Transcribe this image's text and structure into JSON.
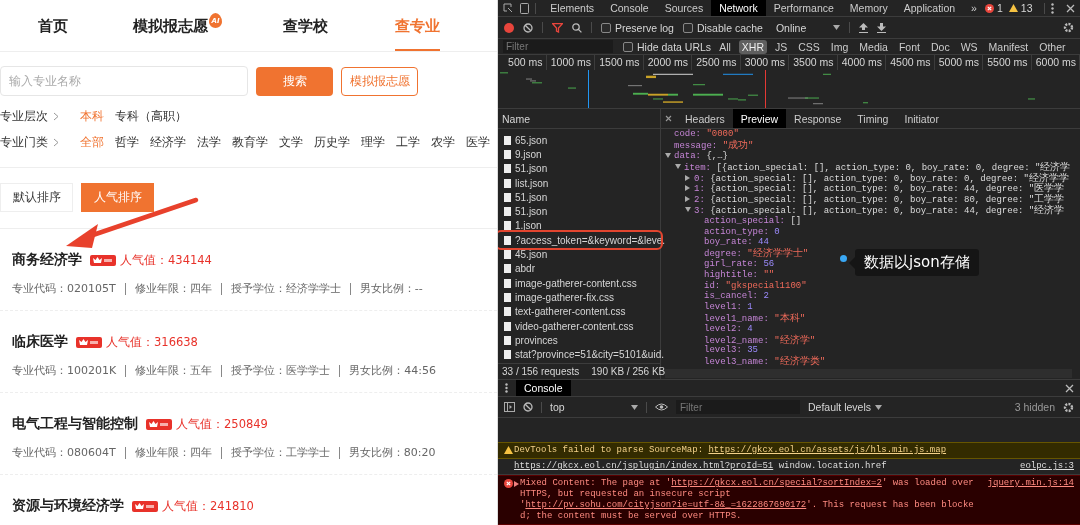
{
  "site": {
    "nav": [
      {
        "label": "首页",
        "selected": false
      },
      {
        "label": "模拟报志愿",
        "selected": false,
        "badge": "AI"
      },
      {
        "label": "查学校",
        "selected": false
      },
      {
        "label": "查专业",
        "selected": true
      }
    ],
    "search": {
      "placeholder": "输入专业名称",
      "button": "搜索",
      "secondary_button": "模拟报志愿"
    },
    "filters": [
      {
        "label": "专业层次",
        "options": [
          {
            "label": "本科",
            "selected": true
          },
          {
            "label": "专科（高职）",
            "selected": false
          }
        ]
      },
      {
        "label": "专业门类",
        "options": [
          {
            "label": "全部",
            "selected": true
          },
          {
            "label": "哲学",
            "selected": false
          },
          {
            "label": "经济学",
            "selected": false
          },
          {
            "label": "法学",
            "selected": false
          },
          {
            "label": "教育学",
            "selected": false
          },
          {
            "label": "文学",
            "selected": false
          },
          {
            "label": "历史学",
            "selected": false
          },
          {
            "label": "理学",
            "selected": false
          },
          {
            "label": "工学",
            "selected": false
          },
          {
            "label": "农学",
            "selected": false
          },
          {
            "label": "医学",
            "selected": false
          }
        ]
      }
    ],
    "sort": [
      {
        "label": "默认排序",
        "selected": false
      },
      {
        "label": "人气排序",
        "selected": true
      }
    ],
    "majors": [
      {
        "name": "商务经济学",
        "popularity": "人气值：434144",
        "details": [
          "专业代码：020105T",
          "修业年限：四年",
          "授予学位：经济学学士",
          "男女比例：--"
        ]
      },
      {
        "name": "临床医学",
        "popularity": "人气值：316638",
        "details": [
          "专业代码：100201K",
          "修业年限：五年",
          "授予学位：医学学士",
          "男女比例：44:56"
        ]
      },
      {
        "name": "电气工程与智能控制",
        "popularity": "人气值：250849",
        "details": [
          "专业代码：080604T",
          "修业年限：四年",
          "授予学位：工学学士",
          "男女比例：80:20"
        ]
      },
      {
        "name": "资源与环境经济学",
        "popularity": "人气值：241810"
      }
    ]
  },
  "devtools": {
    "tabs": [
      {
        "label": "Elements",
        "selected": false
      },
      {
        "label": "Console",
        "selected": false
      },
      {
        "label": "Sources",
        "selected": false
      },
      {
        "label": "Network",
        "selected": true
      },
      {
        "label": "Performance",
        "selected": false
      },
      {
        "label": "Memory",
        "selected": false
      },
      {
        "label": "Application",
        "selected": false
      }
    ],
    "more": "»",
    "errors": "1",
    "warnings": "13",
    "toolbar": {
      "recording": true,
      "filter_open": true,
      "preserve_log": {
        "label": "Preserve log",
        "checked": false
      },
      "disable_cache": {
        "label": "Disable cache",
        "checked": false
      },
      "throttling": "Online"
    },
    "filter_bar": {
      "placeholder": "Filter",
      "hide_data_urls": {
        "label": "Hide data URLs",
        "checked": false
      },
      "types": [
        {
          "label": "All",
          "selected": false
        },
        {
          "label": "XHR",
          "selected": true
        },
        {
          "label": "JS",
          "selected": false
        },
        {
          "label": "CSS",
          "selected": false
        },
        {
          "label": "Img",
          "selected": false
        },
        {
          "label": "Media",
          "selected": false
        },
        {
          "label": "Font",
          "selected": false
        },
        {
          "label": "Doc",
          "selected": false
        },
        {
          "label": "WS",
          "selected": false
        },
        {
          "label": "Manifest",
          "selected": false
        },
        {
          "label": "Other",
          "selected": false
        }
      ]
    },
    "overview": {
      "ticks": [
        "500 ms",
        "1000 ms",
        "1500 ms",
        "2000 ms",
        "2500 ms",
        "3000 ms",
        "3500 ms",
        "4000 ms",
        "4500 ms",
        "5000 ms",
        "5500 ms",
        "6000 ms"
      ]
    },
    "requests": {
      "header": "Name",
      "rows": [
        {
          "name": "65.json",
          "highlighted": false
        },
        {
          "name": "9.json",
          "highlighted": false
        },
        {
          "name": "51.json",
          "highlighted": false
        },
        {
          "name": "list.json",
          "highlighted": false
        },
        {
          "name": "51.json",
          "highlighted": false
        },
        {
          "name": "51.json",
          "highlighted": false
        },
        {
          "name": "1.json",
          "highlighted": false
        },
        {
          "name": "?access_token=&keyword=&leve.",
          "highlighted": true
        },
        {
          "name": "45.json",
          "highlighted": false
        },
        {
          "name": "abdr",
          "highlighted": false
        },
        {
          "name": "image-gatherer-content.css",
          "highlighted": false
        },
        {
          "name": "image-gatherer-fix.css",
          "highlighted": false
        },
        {
          "name": "text-gatherer-content.css",
          "highlighted": false
        },
        {
          "name": "video-gatherer-content.css",
          "highlighted": false
        },
        {
          "name": "provinces",
          "highlighted": false
        },
        {
          "name": "stat?province=51&city=5101&uid.",
          "highlighted": false
        }
      ],
      "summary": [
        "33 / 156 requests",
        "190 KB / 256 KB"
      ]
    },
    "detail": {
      "tabs": [
        {
          "label": "Headers",
          "selected": false
        },
        {
          "label": "Preview",
          "selected": true
        },
        {
          "label": "Response",
          "selected": false
        },
        {
          "label": "Timing",
          "selected": false
        },
        {
          "label": "Initiator",
          "selected": false
        }
      ],
      "tree": [
        {
          "key": "code:",
          "value": "\"0000\"",
          "kind": "string"
        },
        {
          "key": "message:",
          "value": "\"成功\"",
          "kind": "string"
        },
        {
          "key": "data:",
          "value": "{,…}",
          "kind": "object",
          "expanded": true,
          "children": [
            {
              "key": "item:",
              "value": "[{action_special: [], action_type: 0, boy_rate: 0, degree: \"经济学",
              "kind": "object",
              "expanded": true,
              "children": [
                {
                  "key": "0:",
                  "value": "{action_special: [], action_type: 0, boy_rate: 0, degree: \"经济学学",
                  "kind": "object",
                  "expanded": false
                },
                {
                  "key": "1:",
                  "value": "{action_special: [], action_type: 0, boy_rate: 44, degree: \"医学学",
                  "kind": "object",
                  "expanded": false
                },
                {
                  "key": "2:",
                  "value": "{action_special: [], action_type: 0, boy_rate: 80, degree: \"工学学",
                  "kind": "object",
                  "expanded": false
                },
                {
                  "key": "3:",
                  "value": "{action_special: [], action_type: 0, boy_rate: 44, degree: \"经济学",
                  "kind": "object",
                  "expanded": true,
                  "children": [
                    {
                      "key": "action_special:",
                      "value": "[]",
                      "kind": "plain"
                    },
                    {
                      "key": "action_type:",
                      "value": "0",
                      "kind": "number"
                    },
                    {
                      "key": "boy_rate:",
                      "value": "44",
                      "kind": "number"
                    },
                    {
                      "key": "degree:",
                      "value": "\"经济学学士\"",
                      "kind": "string"
                    },
                    {
                      "key": "girl_rate:",
                      "value": "56",
                      "kind": "number"
                    },
                    {
                      "key": "hightitle:",
                      "value": "\"\"",
                      "kind": "string"
                    },
                    {
                      "key": "id:",
                      "value": "\"gkspecial1100\"",
                      "kind": "string"
                    },
                    {
                      "key": "is_cancel:",
                      "value": "2",
                      "kind": "number"
                    },
                    {
                      "key": "level1:",
                      "value": "1",
                      "kind": "number"
                    },
                    {
                      "key": "level1_name:",
                      "value": "\"本科\"",
                      "kind": "string"
                    },
                    {
                      "key": "level2:",
                      "value": "4",
                      "kind": "number"
                    },
                    {
                      "key": "level2_name:",
                      "value": "\"经济学\"",
                      "kind": "string"
                    },
                    {
                      "key": "level3:",
                      "value": "35",
                      "kind": "number"
                    },
                    {
                      "key": "level3_name:",
                      "value": "\"经济学类\"",
                      "kind": "string"
                    }
                  ]
                }
              ]
            }
          ]
        }
      ]
    },
    "tooltip": {
      "text": "数据以json存储"
    },
    "console": {
      "tab": "Console",
      "context": "top",
      "filter_placeholder": "Filter",
      "levels": "Default levels",
      "hidden": "3 hidden",
      "messages": [
        {
          "kind": "warning",
          "parts": [
            {
              "text": "DevTools failed to parse SourceMap: ",
              "link": false
            },
            {
              "text": "https://gkcx.eol.cn/assets/js/hls.min.js.map",
              "link": true
            }
          ]
        },
        {
          "kind": "info",
          "parts": [
            {
              "text": "https://gkcx.eol.cn/jsplugin/index.html?proId=51",
              "link": true
            },
            {
              "text": " window.location.href",
              "link": false
            }
          ],
          "source": "eolpc.js:3"
        },
        {
          "kind": "error",
          "parts": [
            {
              "text": "Mixed Content: The page at '",
              "link": false
            },
            {
              "text": "https://gkcx.eol.cn/special?sortIndex=2",
              "link": true
            },
            {
              "text": "' was loaded over HTTPS, but requested an insecure script '",
              "link": false
            },
            {
              "text": "http://pv.sohu.com/cityjson?ie=utf-8&_=1622867690172",
              "link": true
            },
            {
              "text": "'. This request has been blocked; the content must be served over HTTPS.",
              "link": false
            }
          ],
          "source": "jquery.min.js:14"
        }
      ]
    }
  }
}
